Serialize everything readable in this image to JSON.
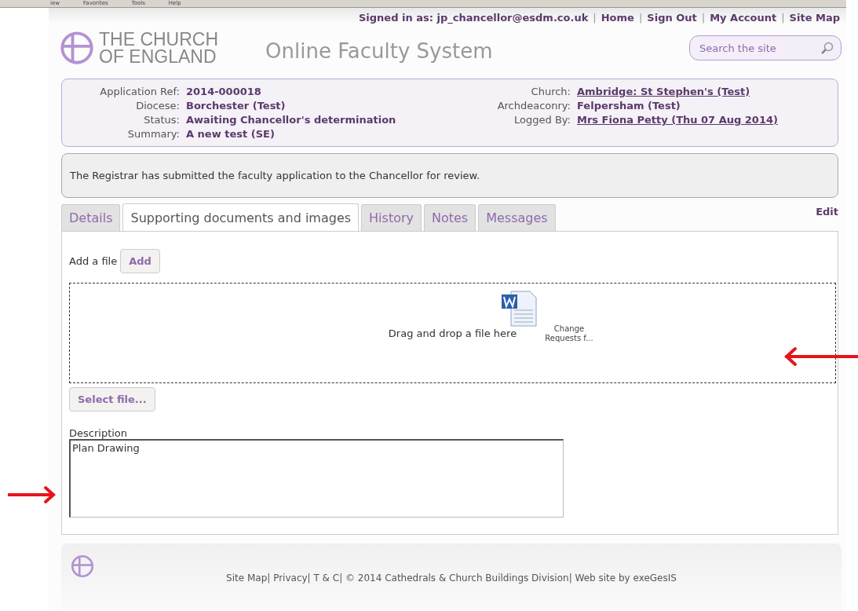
{
  "browser_menu": [
    "iew",
    "Favorites",
    "Tools",
    "Help"
  ],
  "header": {
    "signed_in": "Signed in as: jp_chancellor@esdm.co.uk",
    "links": [
      {
        "separator": "|",
        "label": "Home"
      },
      {
        "separator": "|",
        "label": "Sign Out"
      },
      {
        "separator": "|",
        "label": "My Account"
      },
      {
        "separator": "|",
        "label": "Site Map"
      }
    ],
    "logo_lines": [
      "THE CHURCH",
      "OF ENGLAND"
    ],
    "title": "Online Faculty System",
    "search": {
      "placeholder": "Search the site"
    }
  },
  "summary": {
    "left": [
      {
        "label": "Application Ref:",
        "value": "2014-000018",
        "link": false
      },
      {
        "label": "Diocese:",
        "value": "Borchester (Test)",
        "link": false
      },
      {
        "label": "Status:",
        "value": "Awaiting Chancellor's determination",
        "link": false
      },
      {
        "label": "Summary:",
        "value": "A new test (SE)",
        "link": false
      }
    ],
    "right": [
      {
        "label": "Church:",
        "value": "Ambridge: St Stephen's (Test)",
        "link": true
      },
      {
        "label": "Archdeaconry:",
        "value": "Felpersham (Test)",
        "link": false
      },
      {
        "label": "Logged By:",
        "value": "Mrs Fiona Petty (Thu 07 Aug 2014)",
        "link": true
      }
    ]
  },
  "notice": "The Registrar has submitted the faculty application to the Chancellor for review.",
  "tabs": [
    {
      "label": "Details",
      "selected": false
    },
    {
      "label": "Supporting documents and images",
      "selected": true
    },
    {
      "label": "History",
      "selected": false
    },
    {
      "label": "Notes",
      "selected": false
    },
    {
      "label": "Messages",
      "selected": false
    }
  ],
  "edit_link": "Edit",
  "upload": {
    "add_label": "Add a file",
    "add_button": "Add",
    "dropzone_text": "Drag and drop a file here",
    "dragged_file": "Change Requests f...",
    "select_button": "Select file...",
    "description_label": "Description",
    "description_value": "Plan Drawing"
  },
  "annotations": [
    {
      "kind": "arrow_left"
    },
    {
      "kind": "arrow_right"
    }
  ],
  "footer": "Site Map| Privacy| T & C| © 2014 Cathedrals & Church Buildings Division| Web site by exeGesIS"
}
